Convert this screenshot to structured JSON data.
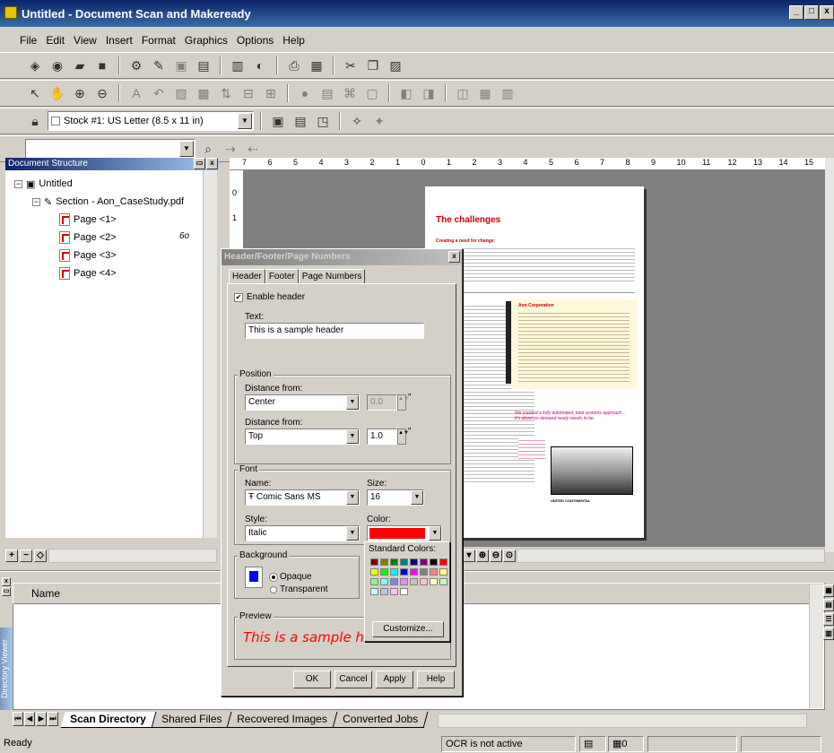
{
  "window": {
    "title": "Untitled - Document Scan and Makeready",
    "min": "_",
    "max": "□",
    "close": "x"
  },
  "menu": [
    "File",
    "Edit",
    "View",
    "Insert",
    "Format",
    "Graphics",
    "Options",
    "Help"
  ],
  "toolbar": {
    "stock": "Stock #1: US Letter (8.5 x 11 in)"
  },
  "structure": {
    "title": "Document Structure",
    "root": "Untitled",
    "section": "Section - Aon_CaseStudy.pdf",
    "pages": [
      "Page <1>",
      "Page <2>",
      "Page <3>",
      "Page <4>"
    ],
    "page2_badge": "6o"
  },
  "ruler": {
    "top": [
      "7",
      "6",
      "5",
      "4",
      "3",
      "2",
      "1",
      "0",
      "1",
      "2",
      "3",
      "4",
      "5",
      "6",
      "7",
      "8",
      "9",
      "10",
      "11",
      "12",
      "13",
      "14",
      "15"
    ],
    "left": [
      "0",
      "1"
    ]
  },
  "preview_page": {
    "heading": "The challenges",
    "intro_label": "Creating a need for change:",
    "sidebar_title": "Aon Corporation",
    "quote": "We created a fully automated, total systems approach… it's about on demand ready needs to be.",
    "caption": "UNITED CONTINENTAL"
  },
  "dialog": {
    "title": "Header/Footer/Page Numbers",
    "tabs": [
      "Header",
      "Footer",
      "Page Numbers"
    ],
    "enable_header": "Enable header",
    "text_label": "Text:",
    "text_value": "This is a sample header",
    "position_label": "Position",
    "distance_from_1": "Distance from:",
    "h_value": "Center",
    "h_num": "0.0",
    "distance_from_2": "Distance from:",
    "v_value": "Top",
    "v_num": "1.0",
    "unit": "\"",
    "font_label": "Font",
    "name_label": "Name:",
    "font_name": "Comic Sans MS",
    "size_label": "Size:",
    "font_size": "16",
    "style_label": "Style:",
    "font_style": "Italic",
    "color_label": "Color:",
    "color_value": "#ff0000",
    "background_label": "Background",
    "opaque": "Opaque",
    "transparent": "Transparent",
    "preview_label": "Preview",
    "preview_text": "This is a sample header",
    "standard_colors": "Standard Colors:",
    "customize": "Customize...",
    "ok": "OK",
    "cancel": "Cancel",
    "apply": "Apply",
    "help": "Help",
    "palette": [
      "#800000",
      "#808000",
      "#008000",
      "#008080",
      "#000080",
      "#800080",
      "#000000",
      "#ff0000",
      "#ffff00",
      "#00ff00",
      "#00ffff",
      "#0000ff",
      "#ff00ff",
      "#808080",
      "#ff8080",
      "#ffff80",
      "#80ff80",
      "#80ffff",
      "#8080ff",
      "#ff80ff",
      "#c0c0c0",
      "#ffc0c0",
      "#ffffc0",
      "#c0ffc0",
      "#c0ffff",
      "#c0c0ff",
      "#ffc0ff",
      "#ffffff"
    ]
  },
  "directory": {
    "column_name": "Name",
    "side_label": "Directory Viewer",
    "tabs": [
      "Scan Directory",
      "Shared Files",
      "Recovered Images",
      "Converted Jobs"
    ]
  },
  "status": {
    "ready": "Ready",
    "ocr": "OCR is not active",
    "count": "0"
  }
}
